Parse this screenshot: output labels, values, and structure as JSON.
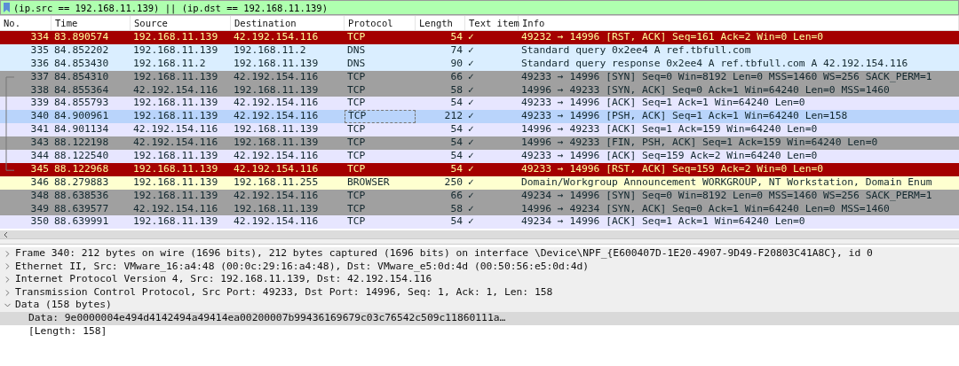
{
  "filter": {
    "value": "(ip.src == 192.168.11.139) || (ip.dst == 192.168.11.139)"
  },
  "packet_list": {
    "columns": [
      "No.",
      "Time",
      "Source",
      "Destination",
      "Protocol",
      "Length",
      "Text item",
      "Info"
    ],
    "rows": [
      {
        "no": "334",
        "time": "83.890574",
        "source": "192.168.11.139",
        "destination": "42.192.154.116",
        "protocol": "TCP",
        "length": "54",
        "text_item": "✓",
        "info": "49232 → 14996 [RST, ACK] Seq=161 Ack=2 Win=0 Len=0",
        "kind": "rst",
        "selected": false
      },
      {
        "no": "335",
        "time": "84.852202",
        "source": "192.168.11.139",
        "destination": "192.168.11.2",
        "protocol": "DNS",
        "length": "74",
        "text_item": "✓",
        "info": "Standard query 0x2ee4 A ref.tbfull.com",
        "kind": "dns",
        "selected": false
      },
      {
        "no": "336",
        "time": "84.853430",
        "source": "192.168.11.2",
        "destination": "192.168.11.139",
        "protocol": "DNS",
        "length": "90",
        "text_item": "✓",
        "info": "Standard query response 0x2ee4 A ref.tbfull.com A 42.192.154.116",
        "kind": "dns",
        "selected": false
      },
      {
        "no": "337",
        "time": "84.854310",
        "source": "192.168.11.139",
        "destination": "42.192.154.116",
        "protocol": "TCP",
        "length": "66",
        "text_item": "✓",
        "info": "49233 → 14996 [SYN] Seq=0 Win=8192 Len=0 MSS=1460 WS=256 SACK_PERM=1",
        "kind": "syn",
        "selected": false
      },
      {
        "no": "338",
        "time": "84.855364",
        "source": "42.192.154.116",
        "destination": "192.168.11.139",
        "protocol": "TCP",
        "length": "58",
        "text_item": "✓",
        "info": "14996 → 49233 [SYN, ACK] Seq=0 Ack=1 Win=64240 Len=0 MSS=1460",
        "kind": "syn",
        "selected": false
      },
      {
        "no": "339",
        "time": "84.855793",
        "source": "192.168.11.139",
        "destination": "42.192.154.116",
        "protocol": "TCP",
        "length": "54",
        "text_item": "✓",
        "info": "49233 → 14996 [ACK] Seq=1 Ack=1 Win=64240 Len=0",
        "kind": "tcp",
        "selected": false
      },
      {
        "no": "340",
        "time": "84.900961",
        "source": "192.168.11.139",
        "destination": "42.192.154.116",
        "protocol": "TCP",
        "length": "212",
        "text_item": "✓",
        "info": "49233 → 14996 [PSH, ACK] Seq=1 Ack=1 Win=64240 Len=158",
        "kind": "tcp",
        "selected": true
      },
      {
        "no": "341",
        "time": "84.901134",
        "source": "42.192.154.116",
        "destination": "192.168.11.139",
        "protocol": "TCP",
        "length": "54",
        "text_item": "✓",
        "info": "14996 → 49233 [ACK] Seq=1 Ack=159 Win=64240 Len=0",
        "kind": "tcp",
        "selected": false
      },
      {
        "no": "343",
        "time": "88.122198",
        "source": "42.192.154.116",
        "destination": "192.168.11.139",
        "protocol": "TCP",
        "length": "54",
        "text_item": "✓",
        "info": "14996 → 49233 [FIN, PSH, ACK] Seq=1 Ack=159 Win=64240 Len=0",
        "kind": "syn",
        "selected": false
      },
      {
        "no": "344",
        "time": "88.122540",
        "source": "192.168.11.139",
        "destination": "42.192.154.116",
        "protocol": "TCP",
        "length": "54",
        "text_item": "✓",
        "info": "49233 → 14996 [ACK] Seq=159 Ack=2 Win=64240 Len=0",
        "kind": "tcp",
        "selected": false
      },
      {
        "no": "345",
        "time": "88.122968",
        "source": "192.168.11.139",
        "destination": "42.192.154.116",
        "protocol": "TCP",
        "length": "54",
        "text_item": "✓",
        "info": "49233 → 14996 [RST, ACK] Seq=159 Ack=2 Win=0 Len=0",
        "kind": "rst",
        "selected": false
      },
      {
        "no": "346",
        "time": "88.279883",
        "source": "192.168.11.139",
        "destination": "192.168.11.255",
        "protocol": "BROWSER",
        "length": "250",
        "text_item": "✓",
        "info": "Domain/Workgroup Announcement WORKGROUP, NT Workstation, Domain Enum",
        "kind": "browser",
        "selected": false
      },
      {
        "no": "348",
        "time": "88.638536",
        "source": "192.168.11.139",
        "destination": "42.192.154.116",
        "protocol": "TCP",
        "length": "66",
        "text_item": "✓",
        "info": "49234 → 14996 [SYN] Seq=0 Win=8192 Len=0 MSS=1460 WS=256 SACK_PERM=1",
        "kind": "syn",
        "selected": false
      },
      {
        "no": "349",
        "time": "88.639577",
        "source": "42.192.154.116",
        "destination": "192.168.11.139",
        "protocol": "TCP",
        "length": "58",
        "text_item": "✓",
        "info": "14996 → 49234 [SYN, ACK] Seq=0 Ack=1 Win=64240 Len=0 MSS=1460",
        "kind": "syn",
        "selected": false
      },
      {
        "no": "350",
        "time": "88.639991",
        "source": "192.168.11.139",
        "destination": "42.192.154.116",
        "protocol": "TCP",
        "length": "54",
        "text_item": "✓",
        "info": "49234 → 14996 [ACK] Seq=1 Ack=1 Win=64240 Len=0",
        "kind": "tcp",
        "selected": false
      }
    ]
  },
  "details": [
    {
      "text": "Frame 340: 212 bytes on wire (1696 bits), 212 bytes captured (1696 bits) on interface \\Device\\NPF_{E600407D-1E20-4907-9D49-F20803C41A8C}, id 0",
      "expanded": false,
      "selected": false
    },
    {
      "text": "Ethernet II, Src: VMware_16:a4:48 (00:0c:29:16:a4:48), Dst: VMware_e5:0d:4d (00:50:56:e5:0d:4d)",
      "expanded": false,
      "selected": false
    },
    {
      "text": "Internet Protocol Version 4, Src: 192.168.11.139, Dst: 42.192.154.116",
      "expanded": false,
      "selected": false
    },
    {
      "text": "Transmission Control Protocol, Src Port: 49233, Dst Port: 14996, Seq: 1, Ack: 1, Len: 158",
      "expanded": false,
      "selected": false
    },
    {
      "text": "Data (158 bytes)",
      "expanded": true,
      "selected": false,
      "children": [
        {
          "text": "Data: 9e0000004e494d4142494a49414ea00200007b99436169679c03c76542c509c11860111a…",
          "selected": true
        },
        {
          "text": "[Length: 158]",
          "selected": false
        }
      ]
    }
  ]
}
